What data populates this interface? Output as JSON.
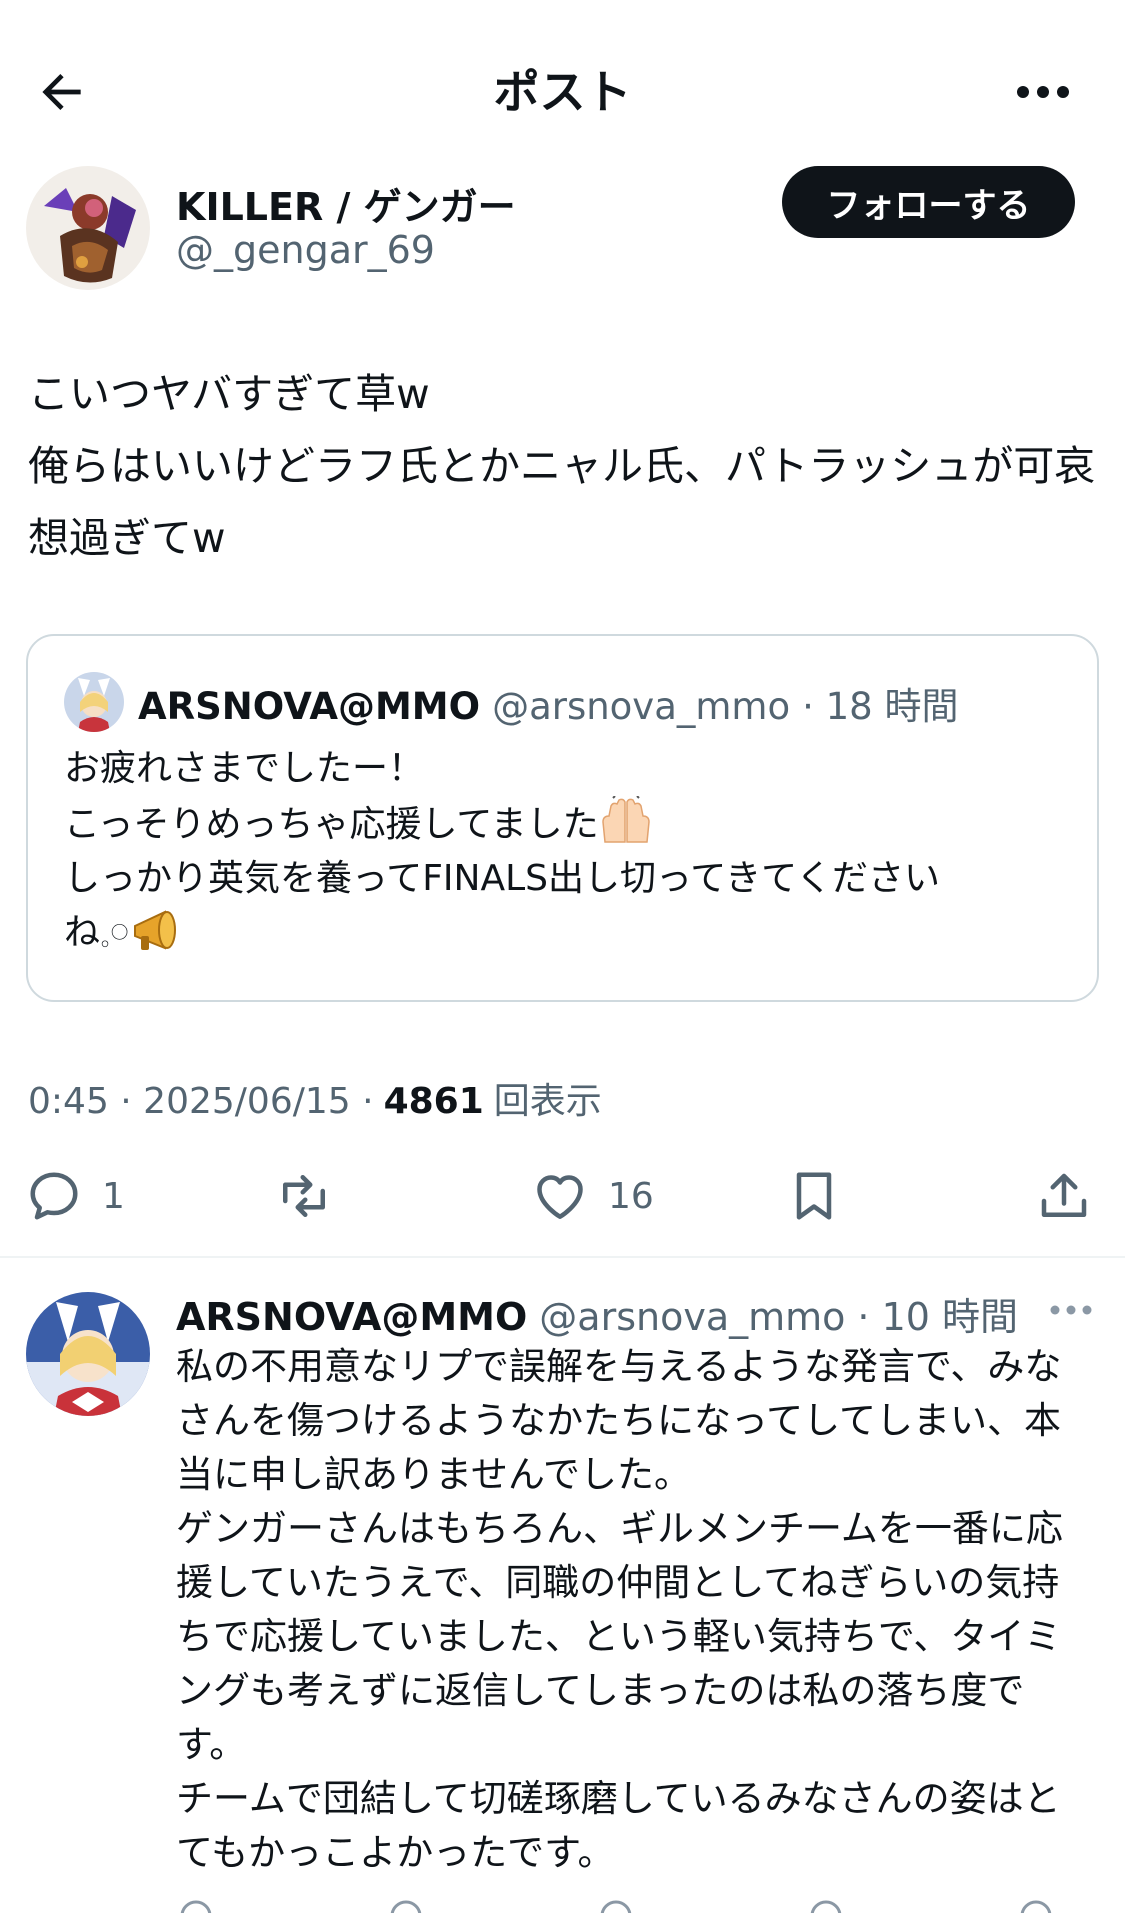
{
  "header": {
    "title": "ポスト",
    "back_icon": "arrow-left-icon",
    "more_icon": "more-horizontal-icon"
  },
  "post": {
    "author": {
      "name": "KILLER / ゲンガー",
      "handle": "@_gengar_69"
    },
    "follow_label": "フォローする",
    "text": "こいつヤバすぎて草w\n俺らはいいけどラフ氏とかニャル氏、パトラッシュが可哀想過ぎてw",
    "quote": {
      "name": "ARSNOVA@MMO",
      "handle": "@arsnova_mmo",
      "time": "· 18 時間",
      "line1": "お疲れさまでしたー！\nこっそりめっちゃ応援してました",
      "line2": "\nしっかり英気を養ってFINALS出し切ってきてください\nね𓈒𓏸",
      "emoji1": "raising-hands-icon",
      "emoji2": "megaphone-icon"
    },
    "meta": {
      "time": "0:45 · 2025/06/15 ·",
      "views": "4861",
      "views_label": "回表示"
    },
    "actions": {
      "reply_count": "1",
      "retweet_count": "",
      "like_count": "16"
    }
  },
  "reply": {
    "name": "ARSNOVA@MMO",
    "handle": "@arsnova_mmo",
    "time": "· 10 時間",
    "text": "私の不用意なリプで誤解を与えるような発言で、みなさんを傷つけるようなかたちになってしてしまい、本当に申し訳ありませんでした。\nゲンガーさんはもちろん、ギルメンチームを一番に応援していたうえで、同職の仲間としてねぎらいの気持ちで応援していました、という軽い気持ちで、タイミングも考えずに返信してしまったのは私の落ち度です。\nチームで団結して切磋琢磨しているみなさんの姿はとてもかっこよかったです。"
  },
  "colors": {
    "text": "#0f1419",
    "secondary": "#536471",
    "border": "#cfd9de",
    "button_bg": "#0f1419"
  }
}
